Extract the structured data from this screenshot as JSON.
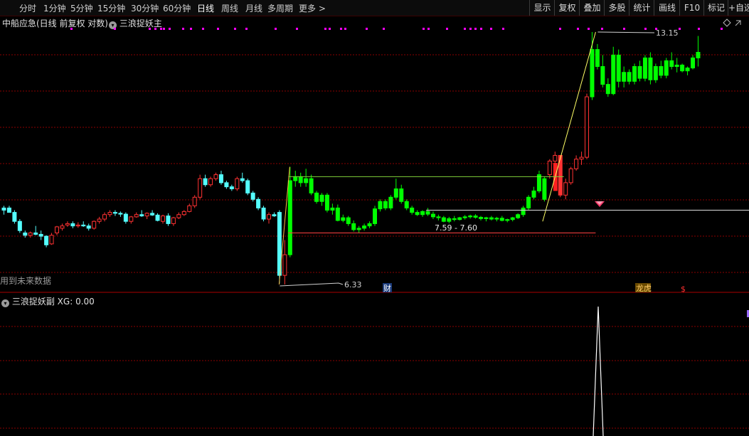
{
  "toolbar": {
    "periods": [
      "分时",
      "1分钟",
      "5分钟",
      "15分钟",
      "30分钟",
      "60分钟",
      "日线",
      "周线",
      "月线",
      "多周期",
      "更多 >"
    ],
    "active_period": "日线",
    "right_buttons": [
      "显示",
      "复权",
      "叠加",
      "多股",
      "统计",
      "画线",
      "F10",
      "标记",
      "+自选"
    ]
  },
  "main_panel": {
    "stock_title": "中船应急(日线 前复权 对数)",
    "indicator_name": "三浪捉妖主",
    "future_data_note": "用到未来数据",
    "high_label": "13.15",
    "low_label": "6.33",
    "range_label": "7.59 - 7.60",
    "event_tags": {
      "finance": "财",
      "dragon_tiger": "龙虎",
      "special": "$"
    }
  },
  "sub_panel": {
    "indicator_name": "三浪捉妖副",
    "xg_label": "XG:",
    "xg_value": "0.00"
  },
  "colors": {
    "up": "#ff3232",
    "down": "#54ffff",
    "signal_up": "#00ff00",
    "grid": "#8b0000",
    "trend_line": "#ffff66",
    "marker": "#ff00ff"
  }
}
